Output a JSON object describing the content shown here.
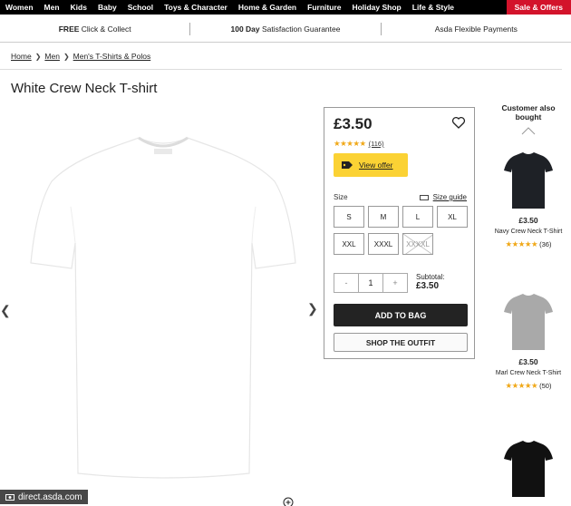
{
  "nav": {
    "items": [
      "Women",
      "Men",
      "Kids",
      "Baby",
      "School",
      "Toys & Character",
      "Home & Garden",
      "Furniture",
      "Holiday Shop",
      "Life & Style"
    ],
    "sale": "Sale & Offers"
  },
  "info": {
    "click_bold": "FREE",
    "click_rest": "Click & Collect",
    "guarantee_bold": "100 Day",
    "guarantee_rest": "Satisfaction Guarantee",
    "payments": "Asda Flexible Payments"
  },
  "breadcrumb": [
    "Home",
    "Men",
    "Men's T-Shirts & Polos"
  ],
  "product": {
    "title": "White Crew Neck T-shirt",
    "price": "£3.50",
    "rating": 4.5,
    "review_count": "(116)",
    "offer_label": "View offer",
    "size_label": "Size",
    "size_guide": "Size guide",
    "sizes": [
      {
        "label": "S",
        "available": true
      },
      {
        "label": "M",
        "available": true
      },
      {
        "label": "L",
        "available": true
      },
      {
        "label": "XL",
        "available": true
      },
      {
        "label": "XXL",
        "available": true
      },
      {
        "label": "XXXL",
        "available": true
      },
      {
        "label": "XXXXL",
        "available": false
      }
    ],
    "qty_minus": "-",
    "qty_value": "1",
    "qty_plus": "+",
    "subtotal_label": "Subtotal:",
    "subtotal_value": "£3.50",
    "add_to_bag": "ADD TO BAG",
    "shop_outfit": "SHOP THE OUTFIT"
  },
  "also_bought": {
    "heading": "Customer also bought",
    "items": [
      {
        "price": "£3.50",
        "name": "Navy Crew Neck T-Shirt",
        "rating": 4.5,
        "count": "(36)",
        "color": "#1e2126"
      },
      {
        "price": "£3.50",
        "name": "Marl Crew Neck T-Shirt",
        "rating": 4.5,
        "count": "(50)",
        "color": "#a9a9a9"
      },
      {
        "color": "#111111"
      }
    ]
  },
  "watermark": "direct.asda.com",
  "colors": {
    "accent_sale": "#d3132b",
    "offer_yellow": "#fbd234",
    "star": "#f0a818"
  }
}
